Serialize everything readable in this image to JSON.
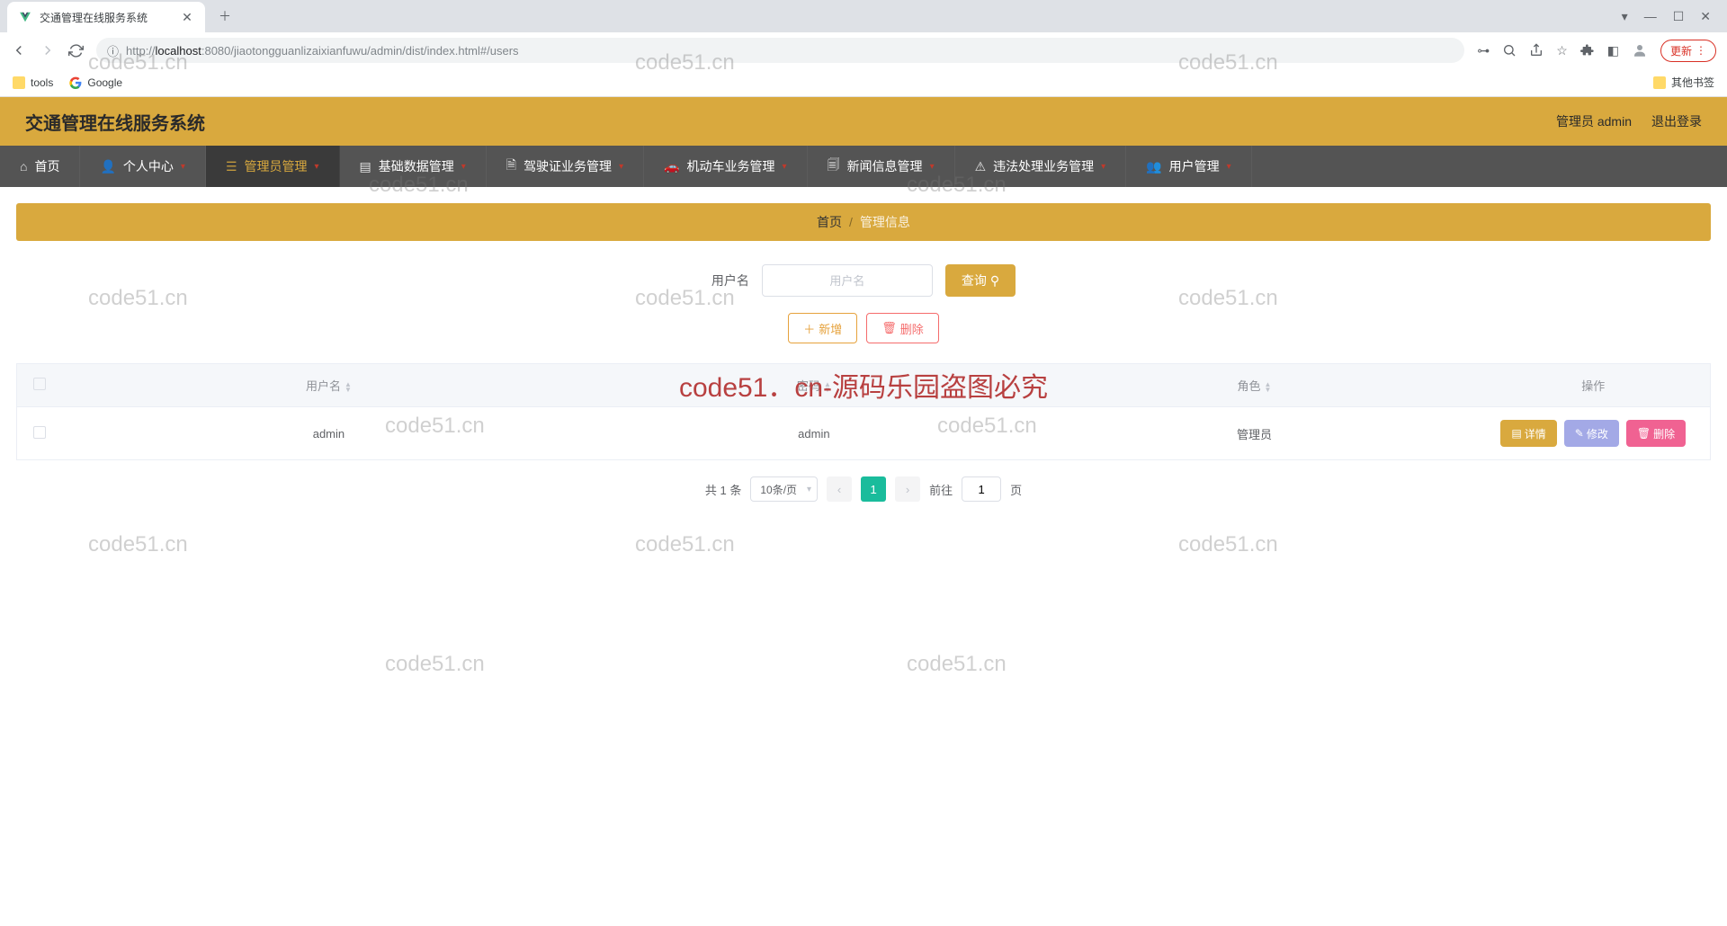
{
  "browser": {
    "tab_title": "交通管理在线服务系统",
    "url_prefix": "http://",
    "url_host": "localhost",
    "url_port": ":8080",
    "url_path": "/jiaotongguanlizaixianfuwu/admin/dist/index.html#/users",
    "update_label": "更新",
    "bookmarks": {
      "tools": "tools",
      "google": "Google",
      "other": "其他书签"
    }
  },
  "header": {
    "title": "交通管理在线服务系统",
    "user_label": "管理员 admin",
    "logout": "退出登录"
  },
  "nav": {
    "items": [
      {
        "label": "首页",
        "dropdown": false
      },
      {
        "label": "个人中心",
        "dropdown": true
      },
      {
        "label": "管理员管理",
        "dropdown": true,
        "active": true
      },
      {
        "label": "基础数据管理",
        "dropdown": true
      },
      {
        "label": "驾驶证业务管理",
        "dropdown": true
      },
      {
        "label": "机动车业务管理",
        "dropdown": true
      },
      {
        "label": "新闻信息管理",
        "dropdown": true
      },
      {
        "label": "违法处理业务管理",
        "dropdown": true
      },
      {
        "label": "用户管理",
        "dropdown": true
      }
    ]
  },
  "breadcrumb": {
    "home": "首页",
    "sep": "/",
    "current": "管理信息"
  },
  "search": {
    "label": "用户名",
    "placeholder": "用户名",
    "button": "查询"
  },
  "actions": {
    "add": "新增",
    "delete": "删除"
  },
  "table": {
    "headers": {
      "username": "用户名",
      "password": "密码",
      "role": "角色",
      "ops": "操作"
    },
    "rows": [
      {
        "username": "admin",
        "password": "admin",
        "role": "管理员"
      }
    ],
    "buttons": {
      "detail": "详情",
      "edit": "修改",
      "delete": "删除"
    }
  },
  "pagination": {
    "total_label": "共 1 条",
    "page_size": "10条/页",
    "current": "1",
    "jump_prefix": "前往",
    "jump_value": "1",
    "jump_suffix": "页"
  },
  "watermark": {
    "small": "code51.cn",
    "big": "code51．cn-源码乐园盗图必究"
  }
}
